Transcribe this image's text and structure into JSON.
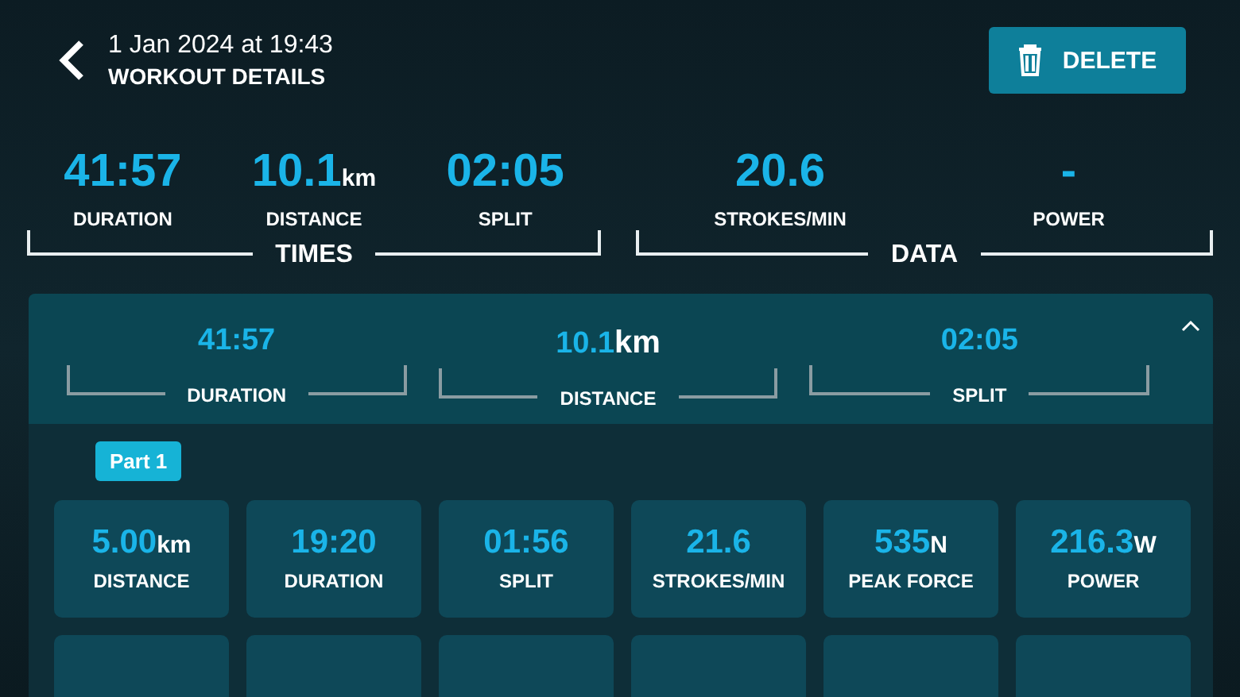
{
  "header": {
    "date": "1 Jan 2024 at 19:43",
    "title": "WORKOUT DETAILS",
    "delete_button": "DELETE"
  },
  "summary_groups": [
    {
      "label": "TIMES",
      "stats": [
        {
          "value": "41:57",
          "label": "DURATION"
        },
        {
          "value": "10.1",
          "unit": "km",
          "label": "DISTANCE"
        },
        {
          "value": "02:05",
          "label": "SPLIT"
        }
      ]
    },
    {
      "label": "DATA",
      "stats": [
        {
          "value": "20.6",
          "label": "STROKES/MIN"
        },
        {
          "value": "-",
          "label": "POWER"
        }
      ]
    }
  ],
  "panel": {
    "expanded": true,
    "summary": [
      {
        "value": "41:57",
        "label": "DURATION"
      },
      {
        "value": "10.1",
        "unit": "km",
        "label": "DISTANCE"
      },
      {
        "value": "02:05",
        "label": "SPLIT"
      }
    ],
    "part_badge": "Part 1",
    "tiles": [
      {
        "value": "5.00",
        "unit": "km",
        "label": "DISTANCE"
      },
      {
        "value": "19:20",
        "label": "DURATION"
      },
      {
        "value": "01:56",
        "label": "SPLIT"
      },
      {
        "value": "21.6",
        "label": "STROKES/MIN"
      },
      {
        "value": "535",
        "unit": "N",
        "label": "PEAK FORCE"
      },
      {
        "value": "216.3",
        "unit": "W",
        "label": "POWER"
      }
    ]
  }
}
